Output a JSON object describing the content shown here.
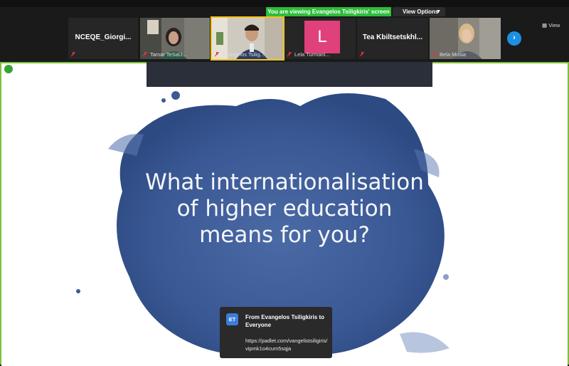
{
  "banner": {
    "viewing_text": "You are viewing Evangelos Tsiligkiris' screen",
    "view_options_label": "View Options",
    "view_label": "View"
  },
  "participants": [
    {
      "name": "NCEQE_Giorgi...",
      "type": "name-only"
    },
    {
      "name": "Tamar TeSaU...",
      "type": "video"
    },
    {
      "name": "Evangelos Tsilig...",
      "type": "video",
      "active": true
    },
    {
      "name": "Lela Turmani...",
      "type": "avatar",
      "avatar_letter": "L"
    },
    {
      "name": "Tea  Kbiltsetskhl...",
      "type": "name-only"
    },
    {
      "name": "Bela Mosia",
      "type": "video"
    }
  ],
  "slide": {
    "title": "What internationalisation of higher education means for you?"
  },
  "chat": {
    "avatar_initials": "ET",
    "from": "From Evangelos Tsiligkiris to Everyone",
    "message": "https://padlet.com/vangelistsiligiris/vipmk1o4cum5sqja"
  },
  "colors": {
    "share_border": "#7cbf3a",
    "banner_green": "#2dbd3a",
    "active_speaker": "#f3c319",
    "slide_blob": "#3d5f9a"
  }
}
